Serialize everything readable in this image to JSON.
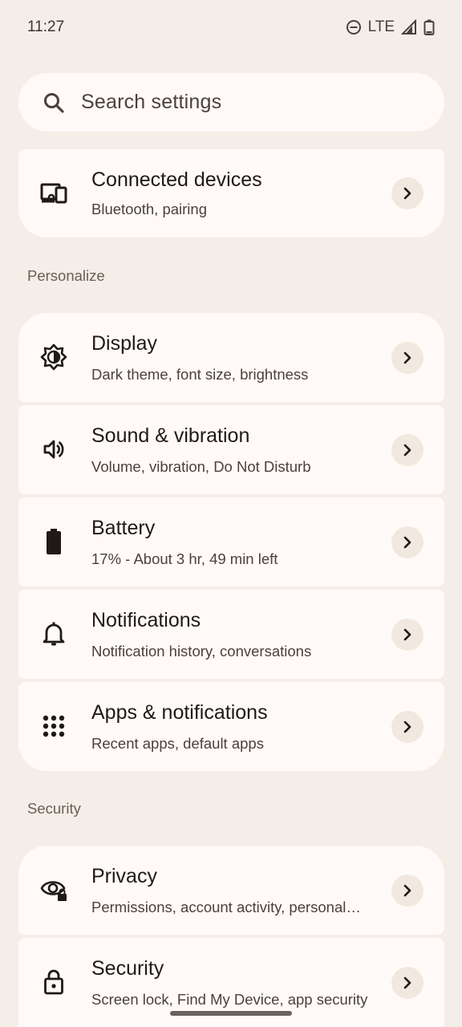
{
  "status_bar": {
    "time": "11:27",
    "network": "LTE",
    "icons": [
      "do-not-disturb-icon",
      "signal-icon",
      "battery-icon"
    ]
  },
  "search": {
    "placeholder": "Search settings",
    "icon": "search-icon"
  },
  "connected_devices": {
    "icon": "devices-icon",
    "title": "Connected devices",
    "summary": "Bluetooth, pairing"
  },
  "sections": {
    "personalize": "Personalize",
    "security": "Security"
  },
  "items": {
    "display": {
      "icon": "brightness-icon",
      "title": "Display",
      "summary": "Dark theme, font size, brightness"
    },
    "sound": {
      "icon": "volume-icon",
      "title": "Sound & vibration",
      "summary": "Volume, vibration, Do Not Disturb"
    },
    "battery": {
      "icon": "battery-icon",
      "title": "Battery",
      "summary": "17% - About 3 hr, 49 min left"
    },
    "notifications": {
      "icon": "bell-icon",
      "title": "Notifications",
      "summary": "Notification history, conversations"
    },
    "apps": {
      "icon": "apps-grid-icon",
      "title": "Apps & notifications",
      "summary": "Recent apps, default apps"
    },
    "privacy": {
      "icon": "privacy-eye-icon",
      "title": "Privacy",
      "summary": "Permissions, account activity, personal…"
    },
    "security": {
      "icon": "lock-icon",
      "title": "Security",
      "summary": "Screen lock, Find My Device, app security"
    }
  },
  "colors": {
    "background": "#f4eee9",
    "card": "#fffaf7",
    "chevron_bg": "#f1e8e0",
    "section_header": "#6c5e52"
  }
}
